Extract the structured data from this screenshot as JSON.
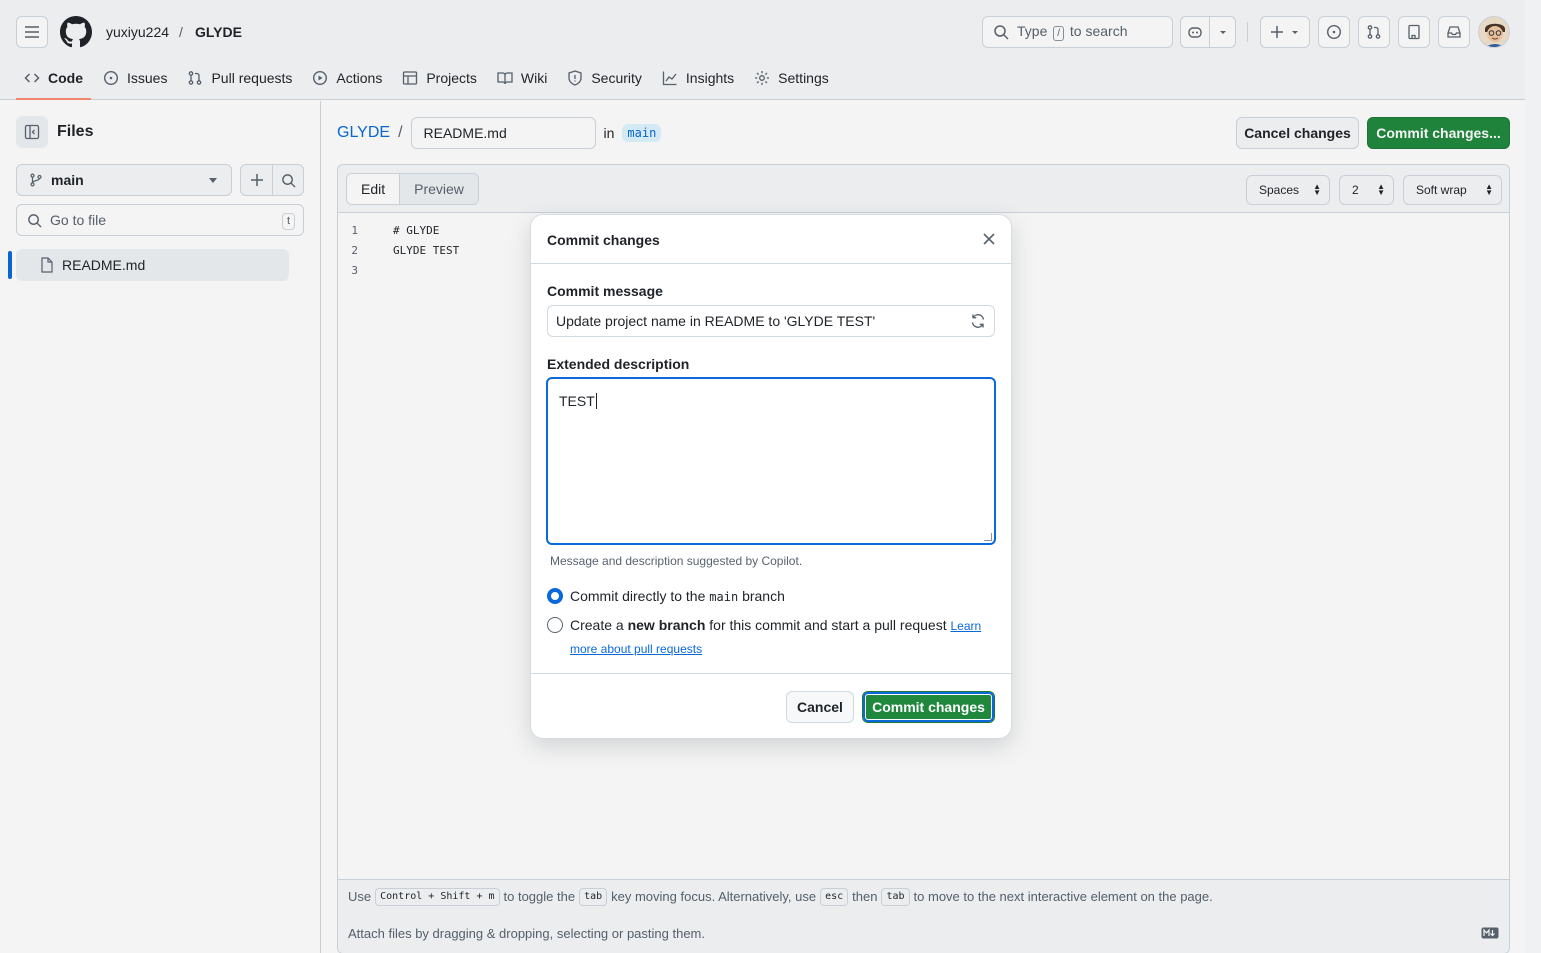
{
  "header": {
    "owner": "yuxiyu224",
    "separator": "/",
    "repo": "GLYDE",
    "search": {
      "pre": "Type",
      "key": "/",
      "post": "to search"
    }
  },
  "nav": [
    {
      "label": "Code",
      "icon": "code-icon",
      "active": true
    },
    {
      "label": "Issues",
      "icon": "issue-opened-icon"
    },
    {
      "label": "Pull requests",
      "icon": "git-pull-request-icon"
    },
    {
      "label": "Actions",
      "icon": "play-icon"
    },
    {
      "label": "Projects",
      "icon": "table-icon"
    },
    {
      "label": "Wiki",
      "icon": "book-icon"
    },
    {
      "label": "Security",
      "icon": "shield-icon"
    },
    {
      "label": "Insights",
      "icon": "graph-icon"
    },
    {
      "label": "Settings",
      "icon": "gear-icon"
    }
  ],
  "sidebar": {
    "title": "Files",
    "branch": "main",
    "goto_placeholder": "Go to file",
    "goto_kbd": "t",
    "files": [
      "README.md"
    ]
  },
  "editor": {
    "repo": "GLYDE",
    "path_sep": "/",
    "filename": "README.md",
    "in_label": "in",
    "branch": "main",
    "cancel_label": "Cancel changes",
    "commit_label": "Commit changes...",
    "tabs": {
      "edit": "Edit",
      "preview": "Preview"
    },
    "indent_mode": "Spaces",
    "indent_size": "2",
    "wrap_mode": "Soft wrap",
    "lines": [
      "# GLYDE",
      "GLYDE TEST",
      ""
    ],
    "footer": {
      "use": "Use",
      "shortcut": "Control + Shift + m",
      "to_toggle": "to toggle the",
      "tab_key": "tab",
      "rest1": "key moving focus. Alternatively, use",
      "esc": "esc",
      "then": "then",
      "rest2": "to move to the next interactive element on the page.",
      "attach": "Attach files by dragging & dropping, selecting or pasting them."
    }
  },
  "dialog": {
    "title": "Commit changes",
    "message_label": "Commit message",
    "message_value": "Update project name in README to 'GLYDE TEST'",
    "description_label": "Extended description",
    "description_value": "TEST",
    "hint": "Message and description suggested by Copilot.",
    "option1": {
      "pre": "Commit directly to the",
      "branch": "main",
      "post": "branch",
      "checked": true
    },
    "option2": {
      "pre": "Create a",
      "bold": "new branch",
      "post": "for this commit and start a pull request",
      "link": "Learn more about pull requests",
      "checked": false
    },
    "cancel_label": "Cancel",
    "commit_label": "Commit changes"
  },
  "colors": {
    "primary": "#1f883d",
    "accent": "#0969da",
    "nav_underline": "#fd8c73"
  }
}
